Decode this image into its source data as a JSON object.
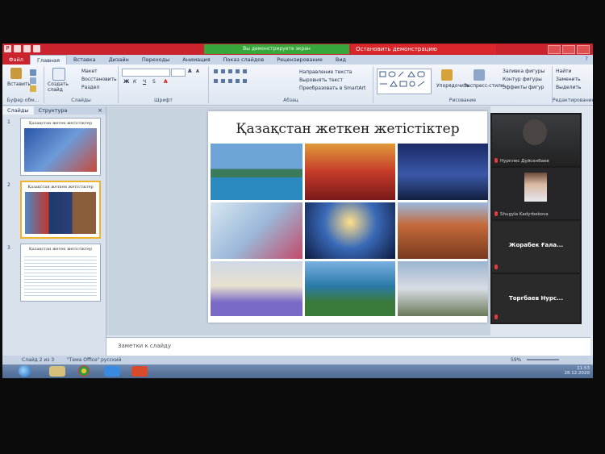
{
  "sharing_bar": {
    "message": "Вы демонстрируете экран",
    "stop_label": "Остановить демонстрацию"
  },
  "ribbon": {
    "tabs": [
      "Файл",
      "Главная",
      "Вставка",
      "Дизайн",
      "Переходы",
      "Анимация",
      "Показ слайдов",
      "Рецензирование",
      "Вид"
    ],
    "clipboard": {
      "paste": "Вставить",
      "label": "Буфер обм..."
    },
    "slides": {
      "new_slide": "Создать слайд",
      "layout": "Макет",
      "reset": "Восстановить",
      "section": "Раздел",
      "label": "Слайды"
    },
    "font": {
      "label": "Шрифт"
    },
    "paragraph": {
      "text_direction": "Направление текста",
      "align_text": "Выровнять текст",
      "smartart": "Преобразовать в SmartArt",
      "label": "Абзац"
    },
    "drawing": {
      "arrange": "Упорядочить",
      "quick_styles": "Экспресс-стили",
      "fill": "Заливка фигуры",
      "outline": "Контур фигуры",
      "effects": "Эффекты фигур",
      "label": "Рисование"
    },
    "editing": {
      "find": "Найти",
      "replace": "Заменить",
      "select": "Выделить",
      "label": "Редактирование"
    }
  },
  "slide_panel": {
    "tabs": [
      "Слайды",
      "Структура"
    ],
    "thumbnails": [
      {
        "number": "1",
        "title": "Қазақстан жетек жетістіктер"
      },
      {
        "number": "2",
        "title": "Қазақстан жеткен жетістіктер"
      },
      {
        "number": "3",
        "title": "Қазақстан жетек жетістіктер"
      }
    ]
  },
  "slide": {
    "title": "Қазақстан жеткен жетістіктер"
  },
  "notes_placeholder": "Заметки к слайду",
  "participants": [
    {
      "name": "Нурплес Дуйсенбаев"
    },
    {
      "name": "Shugyla Kadyrbekova"
    },
    {
      "name": "Жорабек Ғала..."
    },
    {
      "name": "Торгбаев Нурс..."
    }
  ],
  "status": {
    "slide_of": "Слайд 2 из 3",
    "theme": "\"Тема Office\"",
    "language": "русский",
    "zoom": "59%"
  },
  "clock": {
    "time": "11:53",
    "date": "28.12.2020"
  },
  "colors": {
    "office_red": "#c9232d",
    "share_green": "#37a73b",
    "ribbon_bg": "#eef3f9",
    "selection_gold": "#f2b32a"
  }
}
